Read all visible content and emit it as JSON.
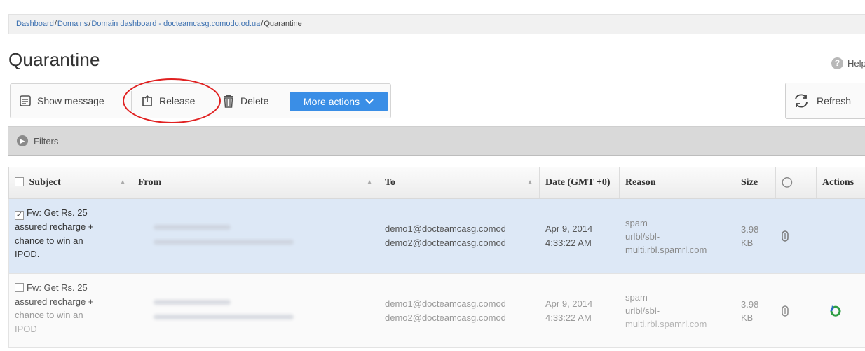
{
  "breadcrumb": {
    "items": [
      "Dashboard",
      "Domains",
      "Domain dashboard - docteamcasg.comodo.od.ua"
    ],
    "current": "Quarantine",
    "separator": "/"
  },
  "page": {
    "title": "Quarantine",
    "help_label": "Help"
  },
  "toolbar": {
    "show_message": "Show message",
    "release": "Release",
    "delete": "Delete",
    "more_actions": "More actions",
    "refresh": "Refresh"
  },
  "filters": {
    "label": "Filters"
  },
  "table": {
    "columns": [
      "Subject",
      "From",
      "To",
      "Date (GMT +0)",
      "Reason",
      "Size",
      "",
      "Actions"
    ],
    "rows": [
      {
        "selected": true,
        "subject_lines": [
          "Fw: Get Rs. 25",
          "assured recharge +",
          "chance to win an",
          "IPOD."
        ],
        "to_lines": [
          "demo1@docteamcasg.comod",
          "demo2@docteamcasg.comod"
        ],
        "date_lines": [
          "Apr 9, 2014",
          "4:33:22 AM"
        ],
        "reason_lines": [
          "spam",
          "urlbl/sbl-",
          "multi.rbl.spamrl.com"
        ],
        "size_lines": [
          "3.98",
          "KB"
        ]
      },
      {
        "selected": false,
        "subject_lines": [
          "Fw: Get Rs. 25",
          "assured recharge +",
          "chance to win an",
          "IPOD"
        ],
        "to_lines": [
          "demo1@docteamcasg.comod",
          "demo2@docteamcasg.comod"
        ],
        "date_lines": [
          "Apr 9, 2014",
          "4:33:22 AM"
        ],
        "reason_lines": [
          "spam",
          "urlbl/sbl-",
          "multi.rbl.spamrl.com"
        ],
        "size_lines": [
          "3.98",
          "KB"
        ]
      }
    ]
  },
  "colors": {
    "accent": "#3a8ee6",
    "link": "#3a6fb0",
    "selected_row": "#dde8f6",
    "annotation": "#e02020"
  },
  "icons": [
    "show-message-icon",
    "release-icon",
    "delete-icon",
    "chevron-down-icon",
    "refresh-icon",
    "help-icon",
    "filters-arrow-icon",
    "attachment-icon",
    "restore-icon"
  ]
}
